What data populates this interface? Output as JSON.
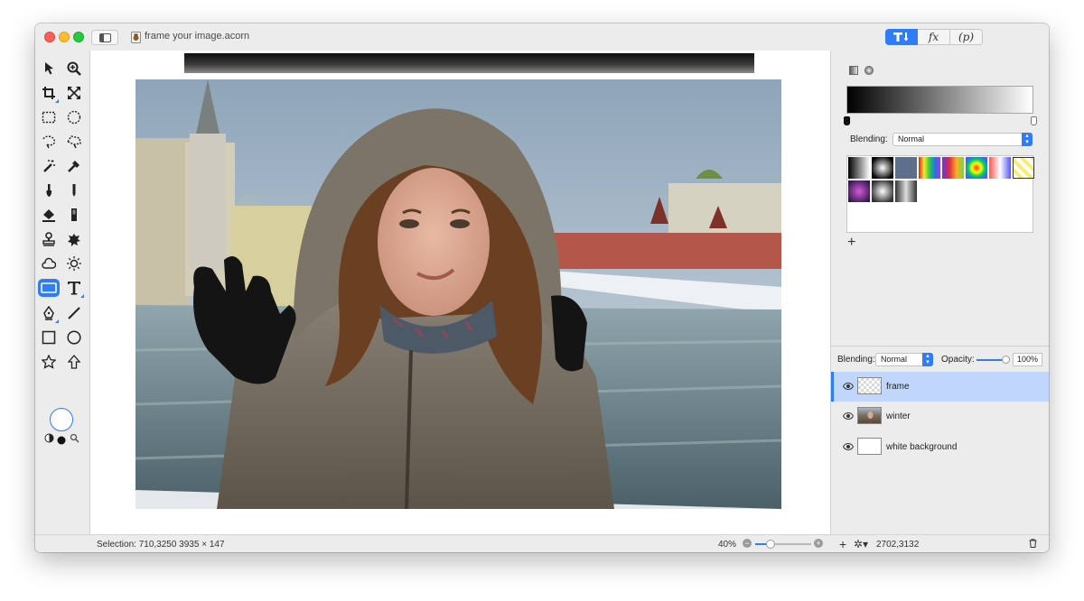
{
  "window": {
    "title": "frame your image.acorn"
  },
  "inspector_tabs": [
    {
      "label": "T",
      "icon": "text-tool-icon",
      "selected": true
    },
    {
      "label": "fx",
      "icon": "filters-icon",
      "selected": false
    },
    {
      "label": "p",
      "icon": "plugins-icon",
      "selected": false
    }
  ],
  "tools": [
    {
      "name": "select-arrow"
    },
    {
      "name": "zoom"
    },
    {
      "name": "crop"
    },
    {
      "name": "transform"
    },
    {
      "name": "rect-select"
    },
    {
      "name": "ellipse-select"
    },
    {
      "name": "lasso"
    },
    {
      "name": "polygon-lasso"
    },
    {
      "name": "magic-wand"
    },
    {
      "name": "color-wand"
    },
    {
      "name": "brush"
    },
    {
      "name": "pencil"
    },
    {
      "name": "paint-bucket"
    },
    {
      "name": "gradient"
    },
    {
      "name": "clone-stamp"
    },
    {
      "name": "splatter"
    },
    {
      "name": "cloud"
    },
    {
      "name": "sun"
    },
    {
      "name": "rectangle-shape",
      "active": true
    },
    {
      "name": "text"
    },
    {
      "name": "bezier-pen"
    },
    {
      "name": "line"
    },
    {
      "name": "rectangle"
    },
    {
      "name": "oval"
    },
    {
      "name": "star"
    },
    {
      "name": "arrow"
    }
  ],
  "gradient": {
    "type": "linear",
    "start_color": "#000000",
    "end_color": "#ffffff",
    "blending_label": "Blending:",
    "blending_value": "Normal",
    "presets": [
      {
        "name": "black-white"
      },
      {
        "name": "radial-black"
      },
      {
        "name": "slate"
      },
      {
        "name": "rainbow"
      },
      {
        "name": "spectrum"
      },
      {
        "name": "radial-rainbow"
      },
      {
        "name": "red-blue-fade"
      },
      {
        "name": "yellow-checker"
      },
      {
        "name": "purple-radial"
      },
      {
        "name": "white-radial"
      },
      {
        "name": "grey-strip"
      }
    ]
  },
  "layers_panel": {
    "blending_label": "Blending:",
    "blending_value": "Normal",
    "opacity_label": "Opacity:",
    "opacity_value": "100%",
    "layers": [
      {
        "name": "frame",
        "visible": true,
        "selected": true,
        "thumb": "checker"
      },
      {
        "name": "winter",
        "visible": true,
        "selected": false,
        "thumb": "photo"
      },
      {
        "name": "white background",
        "visible": true,
        "selected": false,
        "thumb": "white"
      }
    ]
  },
  "status": {
    "selection": "Selection: 710,3250 3935 × 147",
    "zoom": "40%",
    "zoom_level": 0.25,
    "coords": "2702,3132"
  },
  "colors": {
    "accent": "#2f7cf6",
    "selected_row": "#c0d6fb"
  }
}
